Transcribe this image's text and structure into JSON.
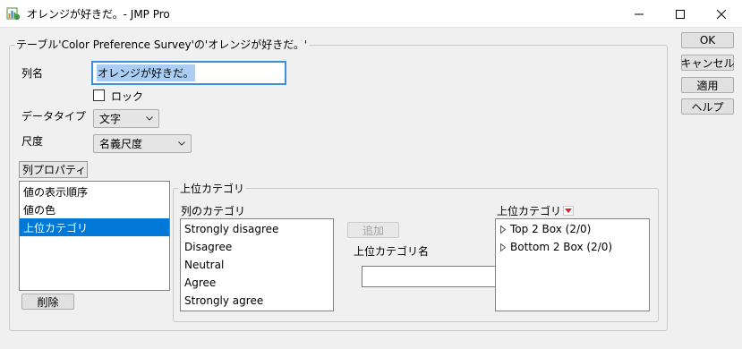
{
  "window": {
    "title": "オレンジが好きだ。- JMP Pro"
  },
  "colors": {
    "accent": "#0078d7",
    "focus_border": "#3c8fd8",
    "text_selection": "#a9cdf3",
    "menu_triangle": "#e0201b"
  },
  "group": {
    "legend": "テーブル'Color Preference Survey'の'オレンジが好きだ。'"
  },
  "column_name": {
    "label": "列名",
    "value": "オレンジが好きだ。"
  },
  "lock": {
    "label": "ロック",
    "checked": false
  },
  "data_type": {
    "label": "データタイプ",
    "selected": "文字"
  },
  "modeling_type": {
    "label": "尺度",
    "selected": "名義尺度"
  },
  "column_properties": {
    "menu_label": "列プロパティ",
    "items": [
      {
        "label": "値の表示順序",
        "selected": false
      },
      {
        "label": "値の色",
        "selected": false
      },
      {
        "label": "上位カテゴリ",
        "selected": true
      }
    ],
    "remove_button": "削除"
  },
  "top_category": {
    "group_legend": "上位カテゴリ",
    "column_categories_label": "列のカテゴリ",
    "column_categories": [
      "Strongly disagree",
      "Disagree",
      "Neutral",
      "Agree",
      "Strongly agree"
    ],
    "add_button": "追加",
    "name_label": "上位カテゴリ名",
    "name_value": "",
    "tree_label": "上位カテゴリ",
    "tree_items": [
      "Top 2 Box (2/0)",
      "Bottom 2 Box (2/0)"
    ]
  },
  "actions": {
    "ok": "OK",
    "cancel": "キャンセル",
    "apply": "適用",
    "help": "ヘルプ"
  }
}
